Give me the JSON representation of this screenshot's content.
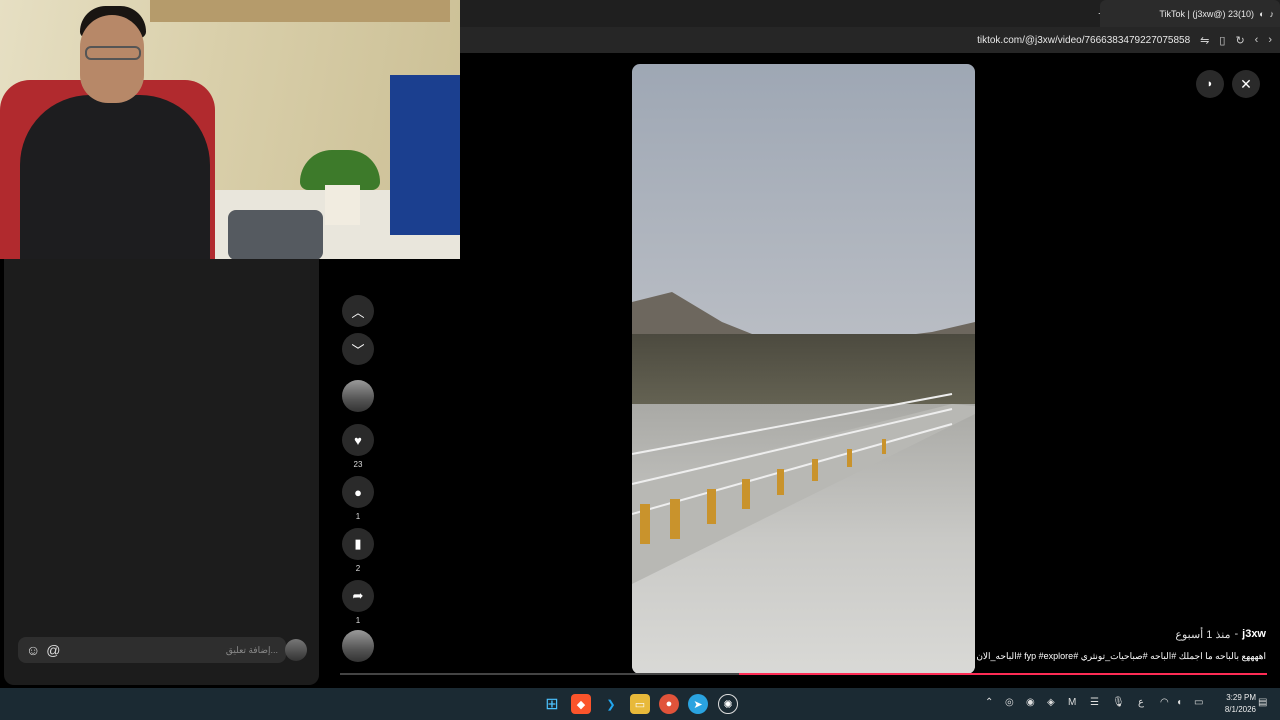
{
  "browser": {
    "tab_title": "TikTok | (j3xw@) 23(10)",
    "url": "tiktok.com/@j3xw/video/7666383479227075858"
  },
  "video": {
    "author": "j3xw",
    "time_ago": "منذ 1 أسبوع",
    "caption": "اههههع بالباحه ما اجملك #الباحه #صباحيات_تونثري #fyp #explore #الباحه_الان",
    "progress": 0.57
  },
  "actions": {
    "likes": "23",
    "comments": "1",
    "saves": "2",
    "shares": "1"
  },
  "comment_box": {
    "placeholder": "إضافة تعليق...",
    "mention_label": "@"
  },
  "icons": {
    "up": "chevron-up-icon",
    "down": "chevron-down-icon",
    "like": "heart-icon",
    "comment": "comment-icon",
    "save": "bookmark-icon",
    "share": "share-icon",
    "close": "close-icon"
  },
  "taskbar": {
    "time": "3:29 PM",
    "date": "8/1/2026",
    "lang": "ع"
  },
  "colors": {
    "accent": "#fe2c55",
    "panel": "#1c1c1c"
  }
}
